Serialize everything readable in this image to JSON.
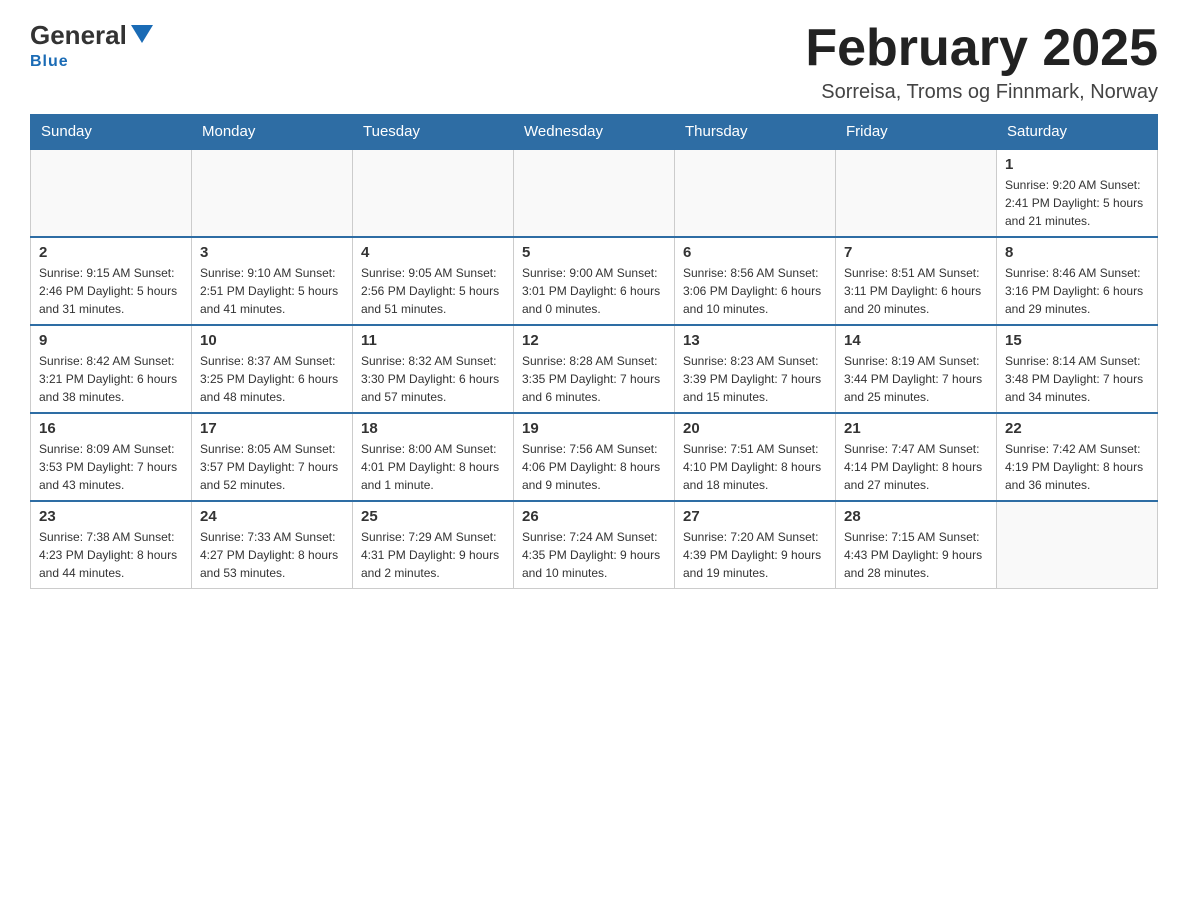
{
  "header": {
    "logo_general": "General",
    "logo_blue": "Blue",
    "title": "February 2025",
    "location": "Sorreisa, Troms og Finnmark, Norway"
  },
  "days_of_week": [
    "Sunday",
    "Monday",
    "Tuesday",
    "Wednesday",
    "Thursday",
    "Friday",
    "Saturday"
  ],
  "weeks": [
    [
      {
        "day": "",
        "info": ""
      },
      {
        "day": "",
        "info": ""
      },
      {
        "day": "",
        "info": ""
      },
      {
        "day": "",
        "info": ""
      },
      {
        "day": "",
        "info": ""
      },
      {
        "day": "",
        "info": ""
      },
      {
        "day": "1",
        "info": "Sunrise: 9:20 AM\nSunset: 2:41 PM\nDaylight: 5 hours\nand 21 minutes."
      }
    ],
    [
      {
        "day": "2",
        "info": "Sunrise: 9:15 AM\nSunset: 2:46 PM\nDaylight: 5 hours\nand 31 minutes."
      },
      {
        "day": "3",
        "info": "Sunrise: 9:10 AM\nSunset: 2:51 PM\nDaylight: 5 hours\nand 41 minutes."
      },
      {
        "day": "4",
        "info": "Sunrise: 9:05 AM\nSunset: 2:56 PM\nDaylight: 5 hours\nand 51 minutes."
      },
      {
        "day": "5",
        "info": "Sunrise: 9:00 AM\nSunset: 3:01 PM\nDaylight: 6 hours\nand 0 minutes."
      },
      {
        "day": "6",
        "info": "Sunrise: 8:56 AM\nSunset: 3:06 PM\nDaylight: 6 hours\nand 10 minutes."
      },
      {
        "day": "7",
        "info": "Sunrise: 8:51 AM\nSunset: 3:11 PM\nDaylight: 6 hours\nand 20 minutes."
      },
      {
        "day": "8",
        "info": "Sunrise: 8:46 AM\nSunset: 3:16 PM\nDaylight: 6 hours\nand 29 minutes."
      }
    ],
    [
      {
        "day": "9",
        "info": "Sunrise: 8:42 AM\nSunset: 3:21 PM\nDaylight: 6 hours\nand 38 minutes."
      },
      {
        "day": "10",
        "info": "Sunrise: 8:37 AM\nSunset: 3:25 PM\nDaylight: 6 hours\nand 48 minutes."
      },
      {
        "day": "11",
        "info": "Sunrise: 8:32 AM\nSunset: 3:30 PM\nDaylight: 6 hours\nand 57 minutes."
      },
      {
        "day": "12",
        "info": "Sunrise: 8:28 AM\nSunset: 3:35 PM\nDaylight: 7 hours\nand 6 minutes."
      },
      {
        "day": "13",
        "info": "Sunrise: 8:23 AM\nSunset: 3:39 PM\nDaylight: 7 hours\nand 15 minutes."
      },
      {
        "day": "14",
        "info": "Sunrise: 8:19 AM\nSunset: 3:44 PM\nDaylight: 7 hours\nand 25 minutes."
      },
      {
        "day": "15",
        "info": "Sunrise: 8:14 AM\nSunset: 3:48 PM\nDaylight: 7 hours\nand 34 minutes."
      }
    ],
    [
      {
        "day": "16",
        "info": "Sunrise: 8:09 AM\nSunset: 3:53 PM\nDaylight: 7 hours\nand 43 minutes."
      },
      {
        "day": "17",
        "info": "Sunrise: 8:05 AM\nSunset: 3:57 PM\nDaylight: 7 hours\nand 52 minutes."
      },
      {
        "day": "18",
        "info": "Sunrise: 8:00 AM\nSunset: 4:01 PM\nDaylight: 8 hours\nand 1 minute."
      },
      {
        "day": "19",
        "info": "Sunrise: 7:56 AM\nSunset: 4:06 PM\nDaylight: 8 hours\nand 9 minutes."
      },
      {
        "day": "20",
        "info": "Sunrise: 7:51 AM\nSunset: 4:10 PM\nDaylight: 8 hours\nand 18 minutes."
      },
      {
        "day": "21",
        "info": "Sunrise: 7:47 AM\nSunset: 4:14 PM\nDaylight: 8 hours\nand 27 minutes."
      },
      {
        "day": "22",
        "info": "Sunrise: 7:42 AM\nSunset: 4:19 PM\nDaylight: 8 hours\nand 36 minutes."
      }
    ],
    [
      {
        "day": "23",
        "info": "Sunrise: 7:38 AM\nSunset: 4:23 PM\nDaylight: 8 hours\nand 44 minutes."
      },
      {
        "day": "24",
        "info": "Sunrise: 7:33 AM\nSunset: 4:27 PM\nDaylight: 8 hours\nand 53 minutes."
      },
      {
        "day": "25",
        "info": "Sunrise: 7:29 AM\nSunset: 4:31 PM\nDaylight: 9 hours\nand 2 minutes."
      },
      {
        "day": "26",
        "info": "Sunrise: 7:24 AM\nSunset: 4:35 PM\nDaylight: 9 hours\nand 10 minutes."
      },
      {
        "day": "27",
        "info": "Sunrise: 7:20 AM\nSunset: 4:39 PM\nDaylight: 9 hours\nand 19 minutes."
      },
      {
        "day": "28",
        "info": "Sunrise: 7:15 AM\nSunset: 4:43 PM\nDaylight: 9 hours\nand 28 minutes."
      },
      {
        "day": "",
        "info": ""
      }
    ]
  ]
}
